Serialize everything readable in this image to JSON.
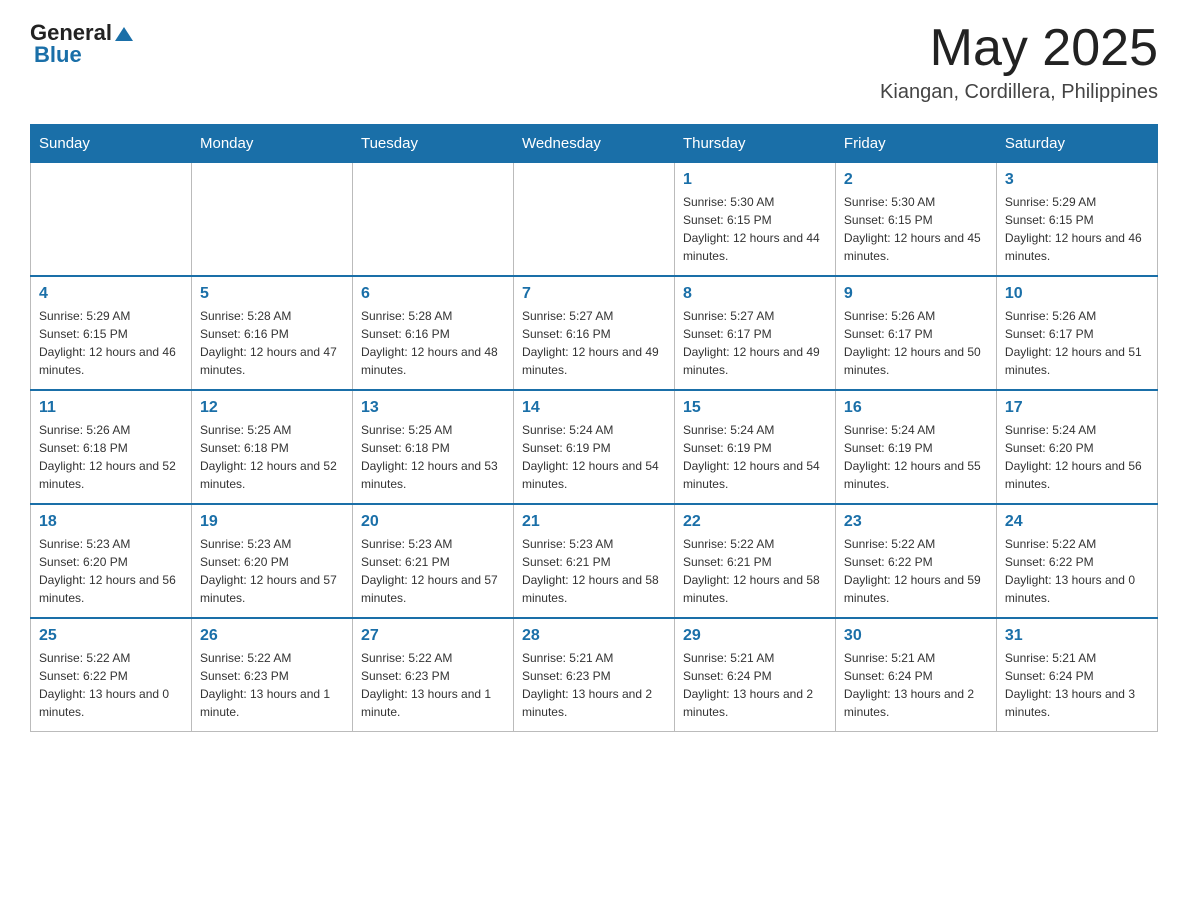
{
  "logo": {
    "text_general": "General",
    "text_blue": "Blue"
  },
  "header": {
    "month_title": "May 2025",
    "location": "Kiangan, Cordillera, Philippines"
  },
  "weekdays": [
    "Sunday",
    "Monday",
    "Tuesday",
    "Wednesday",
    "Thursday",
    "Friday",
    "Saturday"
  ],
  "weeks": [
    [
      {
        "day": "",
        "sunrise": "",
        "sunset": "",
        "daylight": ""
      },
      {
        "day": "",
        "sunrise": "",
        "sunset": "",
        "daylight": ""
      },
      {
        "day": "",
        "sunrise": "",
        "sunset": "",
        "daylight": ""
      },
      {
        "day": "",
        "sunrise": "",
        "sunset": "",
        "daylight": ""
      },
      {
        "day": "1",
        "sunrise": "Sunrise: 5:30 AM",
        "sunset": "Sunset: 6:15 PM",
        "daylight": "Daylight: 12 hours and 44 minutes."
      },
      {
        "day": "2",
        "sunrise": "Sunrise: 5:30 AM",
        "sunset": "Sunset: 6:15 PM",
        "daylight": "Daylight: 12 hours and 45 minutes."
      },
      {
        "day": "3",
        "sunrise": "Sunrise: 5:29 AM",
        "sunset": "Sunset: 6:15 PM",
        "daylight": "Daylight: 12 hours and 46 minutes."
      }
    ],
    [
      {
        "day": "4",
        "sunrise": "Sunrise: 5:29 AM",
        "sunset": "Sunset: 6:15 PM",
        "daylight": "Daylight: 12 hours and 46 minutes."
      },
      {
        "day": "5",
        "sunrise": "Sunrise: 5:28 AM",
        "sunset": "Sunset: 6:16 PM",
        "daylight": "Daylight: 12 hours and 47 minutes."
      },
      {
        "day": "6",
        "sunrise": "Sunrise: 5:28 AM",
        "sunset": "Sunset: 6:16 PM",
        "daylight": "Daylight: 12 hours and 48 minutes."
      },
      {
        "day": "7",
        "sunrise": "Sunrise: 5:27 AM",
        "sunset": "Sunset: 6:16 PM",
        "daylight": "Daylight: 12 hours and 49 minutes."
      },
      {
        "day": "8",
        "sunrise": "Sunrise: 5:27 AM",
        "sunset": "Sunset: 6:17 PM",
        "daylight": "Daylight: 12 hours and 49 minutes."
      },
      {
        "day": "9",
        "sunrise": "Sunrise: 5:26 AM",
        "sunset": "Sunset: 6:17 PM",
        "daylight": "Daylight: 12 hours and 50 minutes."
      },
      {
        "day": "10",
        "sunrise": "Sunrise: 5:26 AM",
        "sunset": "Sunset: 6:17 PM",
        "daylight": "Daylight: 12 hours and 51 minutes."
      }
    ],
    [
      {
        "day": "11",
        "sunrise": "Sunrise: 5:26 AM",
        "sunset": "Sunset: 6:18 PM",
        "daylight": "Daylight: 12 hours and 52 minutes."
      },
      {
        "day": "12",
        "sunrise": "Sunrise: 5:25 AM",
        "sunset": "Sunset: 6:18 PM",
        "daylight": "Daylight: 12 hours and 52 minutes."
      },
      {
        "day": "13",
        "sunrise": "Sunrise: 5:25 AM",
        "sunset": "Sunset: 6:18 PM",
        "daylight": "Daylight: 12 hours and 53 minutes."
      },
      {
        "day": "14",
        "sunrise": "Sunrise: 5:24 AM",
        "sunset": "Sunset: 6:19 PM",
        "daylight": "Daylight: 12 hours and 54 minutes."
      },
      {
        "day": "15",
        "sunrise": "Sunrise: 5:24 AM",
        "sunset": "Sunset: 6:19 PM",
        "daylight": "Daylight: 12 hours and 54 minutes."
      },
      {
        "day": "16",
        "sunrise": "Sunrise: 5:24 AM",
        "sunset": "Sunset: 6:19 PM",
        "daylight": "Daylight: 12 hours and 55 minutes."
      },
      {
        "day": "17",
        "sunrise": "Sunrise: 5:24 AM",
        "sunset": "Sunset: 6:20 PM",
        "daylight": "Daylight: 12 hours and 56 minutes."
      }
    ],
    [
      {
        "day": "18",
        "sunrise": "Sunrise: 5:23 AM",
        "sunset": "Sunset: 6:20 PM",
        "daylight": "Daylight: 12 hours and 56 minutes."
      },
      {
        "day": "19",
        "sunrise": "Sunrise: 5:23 AM",
        "sunset": "Sunset: 6:20 PM",
        "daylight": "Daylight: 12 hours and 57 minutes."
      },
      {
        "day": "20",
        "sunrise": "Sunrise: 5:23 AM",
        "sunset": "Sunset: 6:21 PM",
        "daylight": "Daylight: 12 hours and 57 minutes."
      },
      {
        "day": "21",
        "sunrise": "Sunrise: 5:23 AM",
        "sunset": "Sunset: 6:21 PM",
        "daylight": "Daylight: 12 hours and 58 minutes."
      },
      {
        "day": "22",
        "sunrise": "Sunrise: 5:22 AM",
        "sunset": "Sunset: 6:21 PM",
        "daylight": "Daylight: 12 hours and 58 minutes."
      },
      {
        "day": "23",
        "sunrise": "Sunrise: 5:22 AM",
        "sunset": "Sunset: 6:22 PM",
        "daylight": "Daylight: 12 hours and 59 minutes."
      },
      {
        "day": "24",
        "sunrise": "Sunrise: 5:22 AM",
        "sunset": "Sunset: 6:22 PM",
        "daylight": "Daylight: 13 hours and 0 minutes."
      }
    ],
    [
      {
        "day": "25",
        "sunrise": "Sunrise: 5:22 AM",
        "sunset": "Sunset: 6:22 PM",
        "daylight": "Daylight: 13 hours and 0 minutes."
      },
      {
        "day": "26",
        "sunrise": "Sunrise: 5:22 AM",
        "sunset": "Sunset: 6:23 PM",
        "daylight": "Daylight: 13 hours and 1 minute."
      },
      {
        "day": "27",
        "sunrise": "Sunrise: 5:22 AM",
        "sunset": "Sunset: 6:23 PM",
        "daylight": "Daylight: 13 hours and 1 minute."
      },
      {
        "day": "28",
        "sunrise": "Sunrise: 5:21 AM",
        "sunset": "Sunset: 6:23 PM",
        "daylight": "Daylight: 13 hours and 2 minutes."
      },
      {
        "day": "29",
        "sunrise": "Sunrise: 5:21 AM",
        "sunset": "Sunset: 6:24 PM",
        "daylight": "Daylight: 13 hours and 2 minutes."
      },
      {
        "day": "30",
        "sunrise": "Sunrise: 5:21 AM",
        "sunset": "Sunset: 6:24 PM",
        "daylight": "Daylight: 13 hours and 2 minutes."
      },
      {
        "day": "31",
        "sunrise": "Sunrise: 5:21 AM",
        "sunset": "Sunset: 6:24 PM",
        "daylight": "Daylight: 13 hours and 3 minutes."
      }
    ]
  ]
}
